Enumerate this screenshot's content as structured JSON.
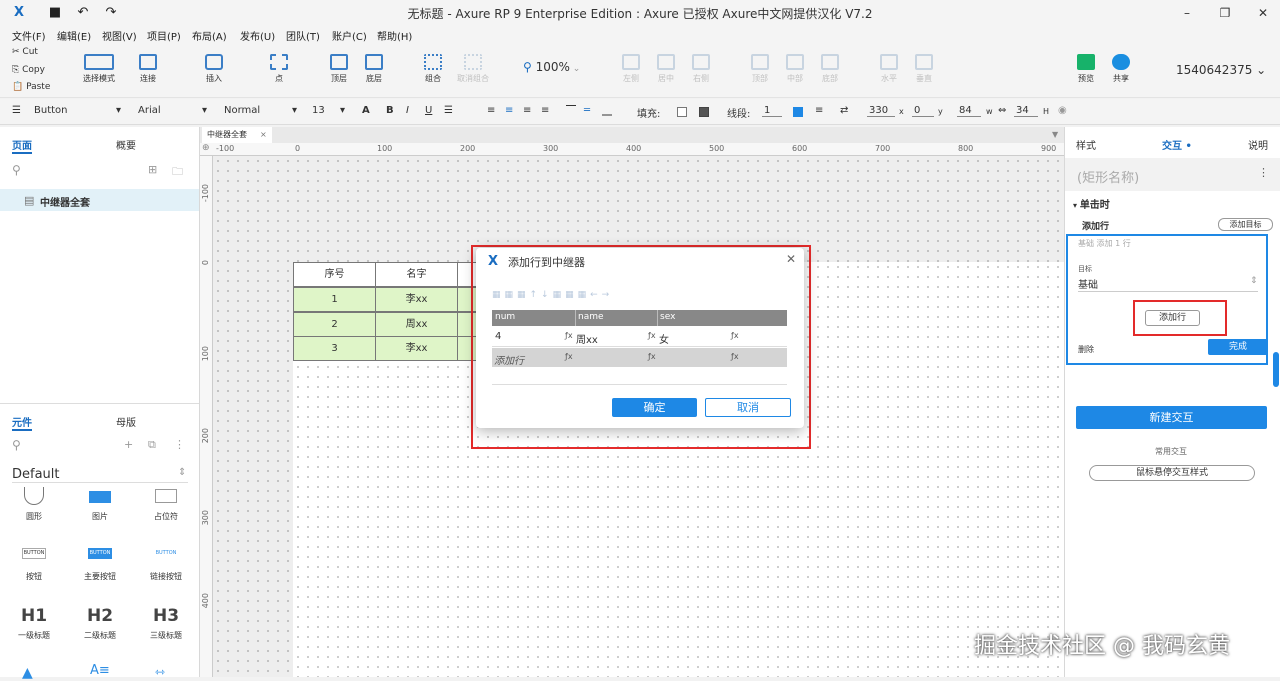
{
  "window": {
    "title": "无标题 - Axure RP 9 Enterprise Edition : Axure 已授权     Axure中文网提供汉化 V7.2"
  },
  "menu": [
    "文件(F)",
    "编辑(E)",
    "视图(V)",
    "项目(P)",
    "布局(A)",
    "发布(U)",
    "团队(T)",
    "账户(C)",
    "帮助(H)"
  ],
  "clipboard": {
    "cut": "Cut",
    "copy": "Copy",
    "paste": "Paste"
  },
  "toolbar": {
    "select_mode": "选择模式",
    "connect": "连接",
    "insert": "插入",
    "point": "点",
    "top": "顶层",
    "bottom": "底层",
    "zoom": "100%",
    "group": "组合",
    "ungroup": "取消组合",
    "left": "左侧",
    "center": "居中",
    "right": "右侧",
    "top_align": "顶部",
    "middle": "中部",
    "bottom_align": "底部",
    "horizontal": "水平",
    "vertical": "垂直",
    "preview": "预览",
    "share": "共享",
    "account": "1540642375"
  },
  "format": {
    "widget_type": "Button",
    "font": "Arial",
    "style": "Normal",
    "size": "13",
    "fill_label": "填充:",
    "line_label": "线段:",
    "line_value": "1",
    "x": "330",
    "y": "0",
    "w": "84",
    "h": "34",
    "x_label": "x",
    "y_label": "y",
    "w_label": "w",
    "h_label": "H"
  },
  "left_panel": {
    "tab_pages": "页面",
    "tab_outline": "概要",
    "page_item": "中继器全套",
    "tab_widgets": "元件",
    "tab_masters": "母版",
    "library": "Default",
    "widgets": [
      {
        "label": "圆形"
      },
      {
        "label": "图片"
      },
      {
        "label": "占位符"
      },
      {
        "label": "按钮",
        "icon": "BUTTON"
      },
      {
        "label": "主要按钮",
        "icon": "BUTTON"
      },
      {
        "label": "链接按钮",
        "icon": "BUTTON"
      },
      {
        "label": "一级标题",
        "icon": "H1"
      },
      {
        "label": "二级标题",
        "icon": "H2"
      },
      {
        "label": "三级标题",
        "icon": "H3"
      }
    ]
  },
  "canvas": {
    "tab": "中继器全套",
    "ruler_h": [
      "-100",
      "0",
      "100",
      "200",
      "300",
      "400",
      "500",
      "600",
      "700",
      "800",
      "900"
    ],
    "ruler_v": [
      "-100",
      "0",
      "100",
      "200",
      "300",
      "400"
    ],
    "table": {
      "headers": [
        "序号",
        "名字"
      ],
      "rows": [
        [
          "1",
          "李xx"
        ],
        [
          "2",
          "周xx"
        ],
        [
          "3",
          "李xx"
        ]
      ]
    }
  },
  "dialog": {
    "title": "添加行到中继器",
    "columns": [
      "num",
      "name",
      "sex"
    ],
    "row": [
      "4",
      "周xx",
      "女"
    ],
    "add_row": "添加行",
    "fx": "ƒx",
    "ok": "确定",
    "cancel": "取消"
  },
  "right_panel": {
    "tab_style": "样式",
    "tab_interact": "交互",
    "tab_notes": "说明",
    "name_placeholder": "(矩形名称)",
    "event": "单击时",
    "action": "添加行",
    "add_target": "添加目标",
    "desc": "基础 添加 1 行",
    "target_label": "目标",
    "target_value": "基础",
    "add_row_btn": "添加行",
    "delete": "删除",
    "done": "完成",
    "new_interaction": "新建交互",
    "common": "常用交互",
    "hover_style": "鼠标悬停交互样式"
  },
  "watermark": "掘金技术社区 @ 我码玄黄"
}
